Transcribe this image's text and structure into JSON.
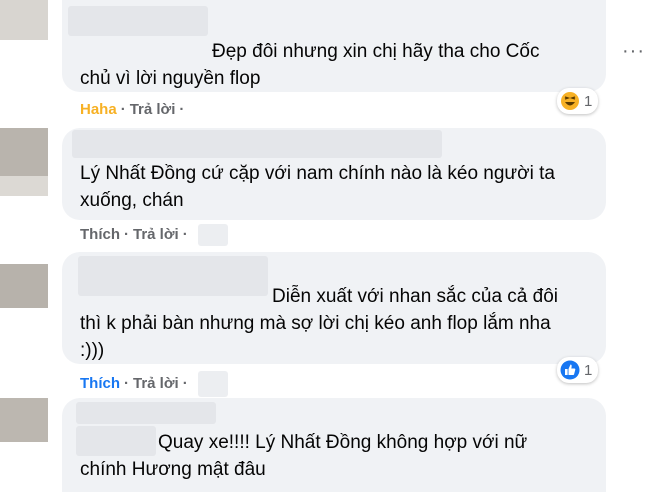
{
  "comments": [
    {
      "text_lines": [
        "Đẹp đôi nhưng xin chị hãy tha cho Cốc",
        "chủ vì lời nguyền flop"
      ],
      "action": "Haha",
      "reply": "Trả lời",
      "reaction_count": "1",
      "reaction_icon": "haha-emoji-icon"
    },
    {
      "text_lines": [
        "Lý Nhất Đồng cứ cặp với nam chính nào là kéo người ta",
        "xuống, chán"
      ],
      "action": "Thích",
      "reply": "Trả lời"
    },
    {
      "text_lines": [
        "Diễn xuất với nhan sắc của cả đôi",
        "thì k phải bàn nhưng mà sợ lời chị kéo anh flop lắm nha",
        ":)))"
      ],
      "action": "Thích",
      "reply": "Trả lời",
      "reaction_count": "1",
      "reaction_icon": "like-icon"
    },
    {
      "text_lines": [
        "Quay xe!!!! Lý Nhất Đồng không hợp với nữ",
        "chính Hương mật đâu"
      ]
    }
  ],
  "colors": {
    "bubble": "#f0f2f5",
    "action_gray": "#65676b",
    "haha": "#f7b125",
    "like_blue": "#1877f2"
  },
  "more_icon": "more-options-icon"
}
